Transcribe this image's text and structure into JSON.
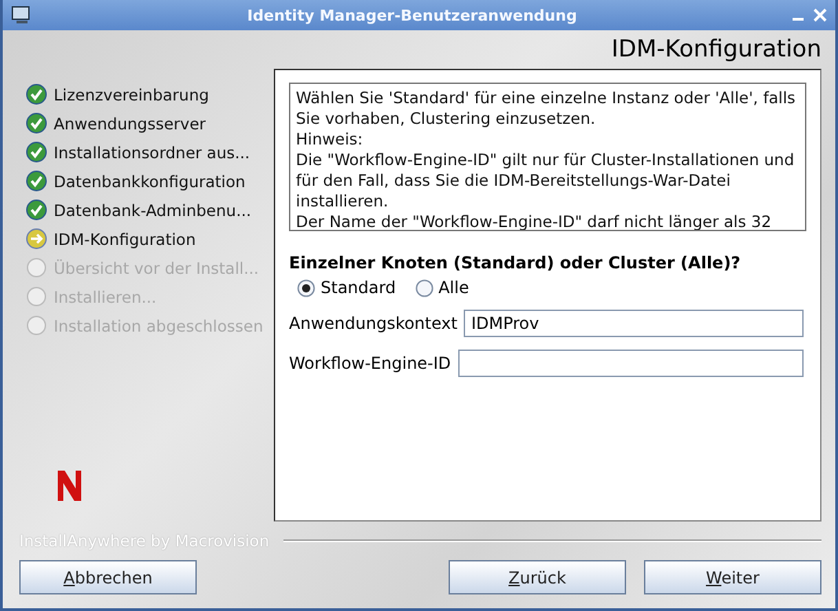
{
  "window": {
    "title": "Identity Manager-Benutzeranwendung"
  },
  "header": {
    "title": "IDM-Konfiguration"
  },
  "steps": [
    {
      "label": "Lizenzvereinbarung",
      "kind": "done"
    },
    {
      "label": "Anwendungsserver",
      "kind": "done"
    },
    {
      "label": "Installationsordner aus...",
      "kind": "done"
    },
    {
      "label": "Datenbankkonfiguration",
      "kind": "done"
    },
    {
      "label": "Datenbank-Adminbenu...",
      "kind": "done"
    },
    {
      "label": "IDM-Konfiguration",
      "kind": "current"
    },
    {
      "label": "Übersicht vor der Install...",
      "kind": "pending"
    },
    {
      "label": "Installieren...",
      "kind": "pending"
    },
    {
      "label": "Installation abgeschlossen",
      "kind": "pending"
    }
  ],
  "info_text": [
    "Wählen Sie 'Standard' für eine einzelne Instanz oder 'Alle', falls Sie vorhaben, Clustering einzusetzen.",
    "Hinweis:",
    "Die \"Workflow-Engine-ID\" gilt nur für Cluster-Installationen und für den Fall, dass Sie die IDM-Bereitstellungs-War-Datei installieren.",
    "Der Name der  \"Workflow-Engine-ID\" darf nicht länger als 32"
  ],
  "question": "Einzelner Knoten (Standard) oder Cluster (Alle)?",
  "options": [
    {
      "label": "Standard",
      "selected": true
    },
    {
      "label": "Alle",
      "selected": false
    }
  ],
  "fields": [
    {
      "label": "Anwendungskontext",
      "value": "IDMProv"
    },
    {
      "label": "Workflow-Engine-ID"
    }
  ],
  "brand": "InstallAnywhere by Macrovision",
  "buttons": {
    "cancel": "Abbrechen",
    "back": "Zurück",
    "next": "Weiter"
  }
}
